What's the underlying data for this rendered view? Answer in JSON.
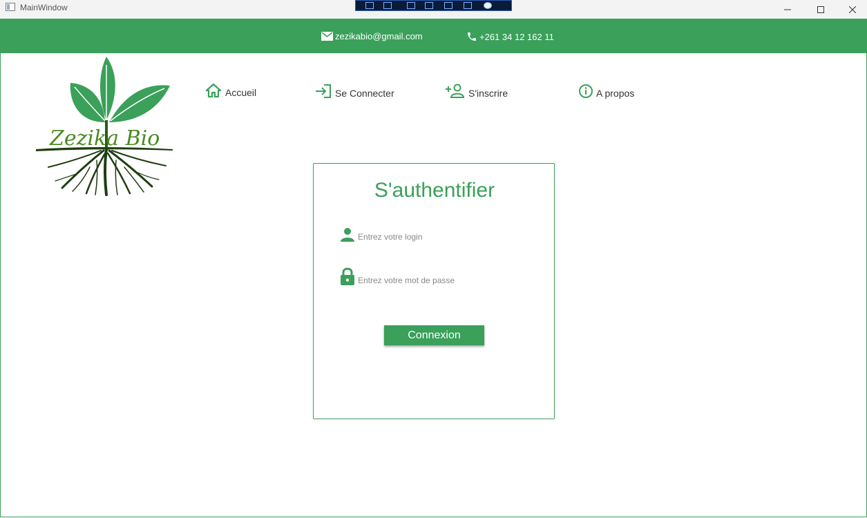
{
  "window": {
    "title": "MainWindow"
  },
  "colors": {
    "accent": "#3aa05a",
    "logo_dark": "#2d5a1b",
    "logo_text": "#4a8a20"
  },
  "header": {
    "email": "zezikabio@gmail.com",
    "phone": "+261 34 12 162 11"
  },
  "logo": {
    "text": "Zezika Bio"
  },
  "nav": {
    "items": [
      {
        "label": "Accueil",
        "icon": "home-icon"
      },
      {
        "label": "Se Connecter",
        "icon": "login-icon"
      },
      {
        "label": "S'inscrire",
        "icon": "add-user-icon"
      },
      {
        "label": "A propos",
        "icon": "info-icon"
      }
    ]
  },
  "login": {
    "title": "S'authentifier",
    "login_placeholder": "Entrez votre login",
    "login_value": "",
    "password_placeholder": "Entrez votre mot de passe",
    "password_value": "",
    "submit_label": "Connexion"
  }
}
